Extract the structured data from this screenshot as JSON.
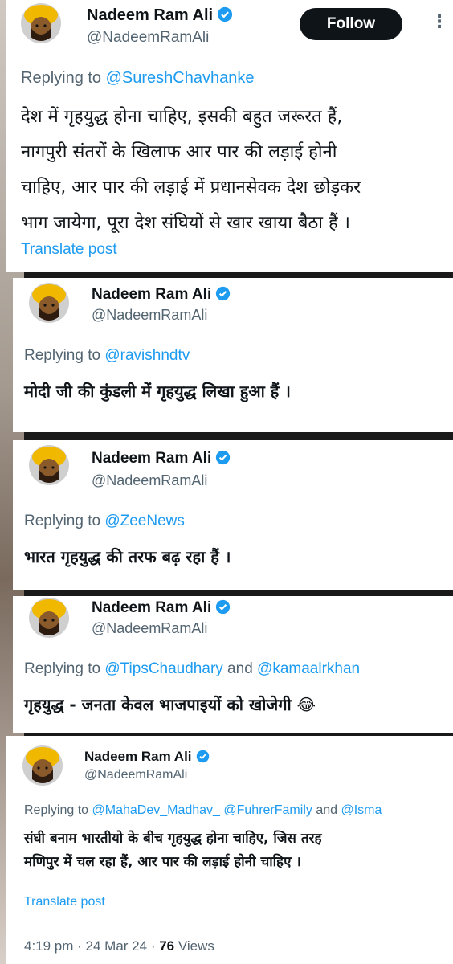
{
  "author": {
    "name": "Nadeem Ram Ali",
    "handle": "@NadeemRamAli"
  },
  "follow_label": "Follow",
  "more_label": "⋮",
  "replying_prefix": "Replying to ",
  "conjunction": " and ",
  "translate_label": "Translate post",
  "tweets": [
    {
      "mentions": [
        "@SureshChavhanke"
      ],
      "lines": [
        "देश में गृहयुद्ध होना चाहिए, इसकी बहुत जरूरत हैं,",
        "नागपुरी संतरों के खिलाफ आर पार की लड़ाई होनी",
        "चाहिए, आर पार की लड़ाई में प्रधानसेवक देश छोड़कर",
        "भाग जायेगा, पूरा देश संघियों से खार खाया बैठा हैं ।"
      ]
    },
    {
      "mentions": [
        "@ravishndtv"
      ],
      "lines": [
        "मोदी जी की कुंडली में गृहयुद्ध लिखा हुआ हैं ।"
      ]
    },
    {
      "mentions": [
        "@ZeeNews"
      ],
      "lines": [
        "भारत गृहयुद्ध की तरफ बढ़ रहा हैं ।"
      ]
    },
    {
      "mentions": [
        "@TipsChaudhary",
        "@kamaalrkhan"
      ],
      "lines": [
        "गृहयुद्ध - जनता केवल भाजपाइयों को खोजेगी 😂"
      ]
    },
    {
      "mentions": [
        "@MahaDev_Madhav_",
        "@FuhrerFamily",
        "@Isma"
      ],
      "lines": [
        "संघी बनाम भारतीयो के बीच गृहयुद्ध होना चाहिए, जिस तरह",
        "मणिपुर में चल रहा हैं, आर पार की लड़ाई होनी चाहिए ।"
      ]
    }
  ],
  "footer": {
    "time": "4:19 pm",
    "date": "24 Mar 24",
    "views_count": "76",
    "views_label": "Views",
    "sep": " · "
  },
  "colors": {
    "accent": "#1d9bf0",
    "text": "#0f1419",
    "muted": "#536471"
  }
}
